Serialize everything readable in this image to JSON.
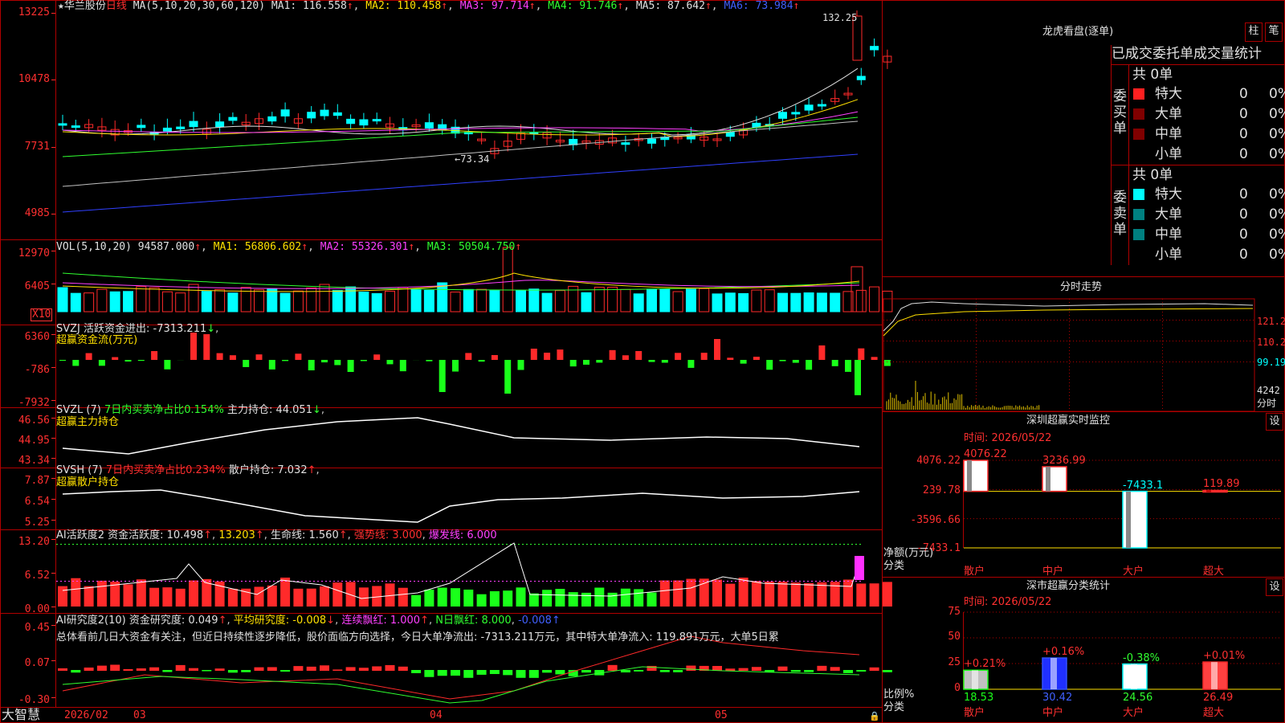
{
  "header": {
    "star": "★",
    "stock": "华兰股份",
    "period": "日线",
    "ma_prefix": "MA(5,10,20,30,60,120)",
    "ma1": "MA1: 116.558",
    "ma2": "MA2: 110.458",
    "ma3": "MA3: 97.714",
    "ma4": "MA4: 91.746",
    "ma5": "MA5: 87.642",
    "ma6": "MA6: 73.984",
    "high_mark": "132.25",
    "low_mark": "73.34"
  },
  "price_axis": [
    "13225",
    "10478",
    "7731",
    "4985"
  ],
  "vol": {
    "prefix": "VOL(5,10,20)",
    "value": "94587.000",
    "ma1": "MA1: 56806.602",
    "ma2": "MA2: 55326.301",
    "ma3": "MA3: 50504.750",
    "axis": [
      "12970",
      "6405"
    ],
    "unit": "X10"
  },
  "svzj": {
    "title": "SVZJ  活跃资金进出: -7313.211",
    "subtitle": "超赢资金流(万元)",
    "axis": [
      "6360",
      "-786",
      "-7932"
    ]
  },
  "svzl": {
    "prefix": "SVZL (7)",
    "net": "7日内买卖净占比0.154%",
    "hold": "主力持仓: 44.051",
    "subtitle": "超赢主力持仓",
    "axis": [
      "46.56",
      "44.95",
      "43.34"
    ]
  },
  "svsh": {
    "prefix": "SVSH (7)",
    "net": "7日内买卖净占比0.234%",
    "hold": "散户持仓: 7.032",
    "subtitle": "超赢散户持仓",
    "axis": [
      "7.87",
      "6.54",
      "5.25"
    ]
  },
  "ai_active": {
    "prefix": "AI活跃度2",
    "v1": "资金活跃度: 10.498",
    "v2": "13.203",
    "v3": "生命线: 1.560",
    "v4": "强势线: 3.000",
    "v5": "爆发线: 6.000",
    "axis": [
      "13.20",
      "6.52",
      "0.00"
    ]
  },
  "ai_research": {
    "prefix": "AI研究度2(10)",
    "v1": "资金研究度: 0.049",
    "v2": "平均研究度: -0.008",
    "v3": "连续飘红: 1.000",
    "v4": "N日飘红: 8.000",
    "v5": "-0.008",
    "desc": "总体看前几日大资金有关注，但近日持续性逐步降低，股价面临方向选择，今日大单净流出: -7313.211万元，其中特大单净流入: 119.891万元，大单5日累",
    "axis": [
      "0.45",
      "0.07",
      "-0.30"
    ]
  },
  "bottom_bar": {
    "brand": "大智慧",
    "dates": [
      "2026/02",
      "03",
      "04",
      "05"
    ]
  },
  "dragon": {
    "title": "龙虎看盘(逐单)",
    "btn_bar": "柱",
    "btn_stroke": "笔",
    "tabs_text": "已成交委托单成交量统计",
    "buy_label": "委买单",
    "sell_label": "委卖单",
    "buy_total": "共 0单",
    "sell_total": "共 0单",
    "buy_rows": [
      {
        "name": "特大",
        "count": "0",
        "pct": "0%",
        "color": "#ff2020"
      },
      {
        "name": "大单",
        "count": "0",
        "pct": "0%",
        "color": "#800000"
      },
      {
        "name": "中单",
        "count": "0",
        "pct": "0%",
        "color": "#800000"
      },
      {
        "name": "小单",
        "count": "0",
        "pct": "0%",
        "color": ""
      }
    ],
    "sell_rows": [
      {
        "name": "特大",
        "count": "0",
        "pct": "0%",
        "color": "#00ffff"
      },
      {
        "name": "大单",
        "count": "0",
        "pct": "0%",
        "color": "#008080"
      },
      {
        "name": "中单",
        "count": "0",
        "pct": "0%",
        "color": "#008080"
      },
      {
        "name": "小单",
        "count": "0",
        "pct": "0%",
        "color": ""
      }
    ]
  },
  "intraday": {
    "title": "分时走势",
    "axis": [
      "121.2",
      "110.2",
      "99.19",
      "4242"
    ],
    "unit": "分时"
  },
  "sz_monitor": {
    "title": "深圳超赢实时监控",
    "set_btn": "设",
    "time": "时间: 2026/05/22",
    "axis": [
      "4076.22",
      "239.78",
      "-3596.66",
      "-7433.1"
    ],
    "unit": "净额(万元)",
    "cat_label": "分类",
    "chart_data": {
      "type": "bar",
      "categories": [
        "散户",
        "中户",
        "大户",
        "超大"
      ],
      "values": [
        4076.22,
        3236.99,
        -7433.1,
        119.89
      ],
      "value_labels": [
        "4076.22",
        "3236.99",
        "-7433.1",
        "119.89"
      ],
      "ylim": [
        -7433.1,
        4076.22
      ]
    }
  },
  "sz_class": {
    "title": "深市超赢分类统计",
    "set_btn": "设",
    "time": "时间: 2026/05/22",
    "axis": [
      "75",
      "50",
      "25",
      "0"
    ],
    "unit": "比例%",
    "cat_label": "分类",
    "chart_data": {
      "type": "bar",
      "categories": [
        "散户",
        "中户",
        "大户",
        "超大"
      ],
      "values": [
        18.53,
        30.42,
        24.56,
        26.49
      ],
      "value_labels": [
        "18.53",
        "30.42",
        "24.56",
        "26.49"
      ],
      "changes": [
        "+0.21%",
        "+0.16%",
        "-0.38%",
        "+0.01%"
      ],
      "ylim": [
        0,
        75
      ]
    }
  }
}
